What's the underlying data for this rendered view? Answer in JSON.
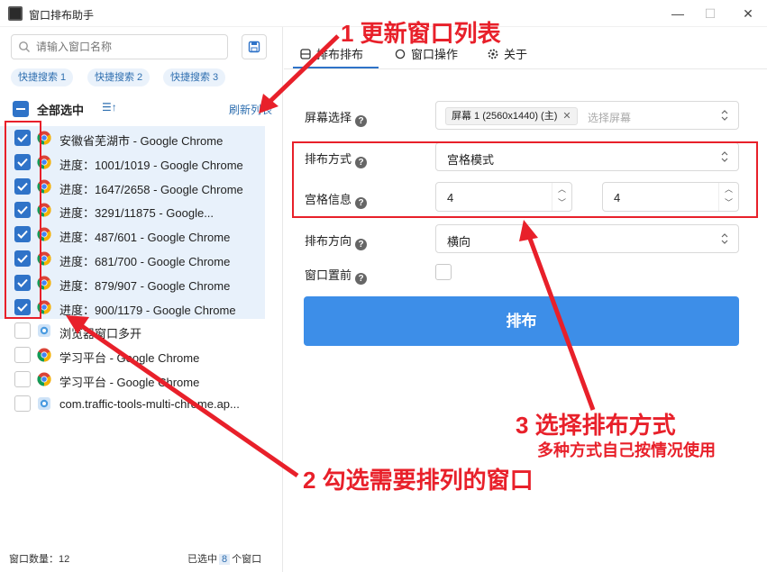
{
  "window": {
    "title": "窗口排布助手",
    "controls": {
      "minimize": "—",
      "maximize": "☐",
      "close": "✕"
    }
  },
  "sidebar": {
    "search_placeholder": "请输入窗口名称",
    "quick_tags": [
      "快捷搜索 1",
      "快捷搜索 2",
      "快捷搜索 3"
    ],
    "select_all_label": "全部选中",
    "refresh_label": "刷新列表",
    "items": [
      {
        "label": "安徽省芜湖市 - Google Chrome",
        "checked": true,
        "icon": "chrome-icon"
      },
      {
        "label": "进度：1001/1019 - Google Chrome",
        "checked": true,
        "icon": "chrome-icon"
      },
      {
        "label": "进度：1647/2658 - Google Chrome",
        "checked": true,
        "icon": "chrome-icon"
      },
      {
        "label": "进度：3291/11875 - Google...",
        "checked": true,
        "icon": "chrome-icon"
      },
      {
        "label": "进度：487/601 - Google Chrome",
        "checked": true,
        "icon": "chrome-icon"
      },
      {
        "label": "进度：681/700 - Google Chrome",
        "checked": true,
        "icon": "chrome-icon"
      },
      {
        "label": "进度：879/907 - Google Chrome",
        "checked": true,
        "icon": "chrome-icon"
      },
      {
        "label": "进度：900/1179 - Google Chrome",
        "checked": true,
        "icon": "chrome-icon"
      },
      {
        "label": "浏览器窗口多开",
        "checked": false,
        "icon": "app-icon"
      },
      {
        "label": "学习平台 - Google Chrome",
        "checked": false,
        "icon": "chrome-icon"
      },
      {
        "label": "学习平台 - Google Chrome",
        "checked": false,
        "icon": "chrome-icon"
      },
      {
        "label": "com.traffic-tools-multi-chrome.ap...",
        "checked": false,
        "icon": "app-icon"
      }
    ],
    "footer": {
      "window_count_label": "窗口数量：",
      "window_count": "12",
      "selected_prefix": "已选中",
      "selected_count": "8",
      "selected_suffix": "个窗口"
    }
  },
  "tabs": [
    {
      "label": "排布排布",
      "icon": "grid-icon",
      "active": true
    },
    {
      "label": "窗口操作",
      "icon": "chat-icon",
      "active": false
    },
    {
      "label": "关于",
      "icon": "gear-icon",
      "active": false
    }
  ],
  "form": {
    "screen_label": "屏幕选择",
    "screen_chip": "屏幕 1 (2560x1440) (主)",
    "screen_placeholder": "选择屏幕",
    "mode_label": "排布方式",
    "mode_value": "宫格模式",
    "grid_label": "宫格信息",
    "grid_rows": "4",
    "grid_cols": "4",
    "direction_label": "排布方向",
    "direction_value": "横向",
    "front_label": "窗口置前",
    "front_checked": false,
    "arrange_button": "排布"
  },
  "annotations": {
    "a1": "1 更新窗口列表",
    "a2": "2 勾选需要排列的窗口",
    "a3_title": "3 选择排布方式",
    "a3_sub": "多种方式自己按情况使用"
  },
  "colors": {
    "accent": "#2f73c8",
    "button": "#3d8ee8",
    "annotation": "#e8202a",
    "selected_row": "#e8f1fb"
  }
}
